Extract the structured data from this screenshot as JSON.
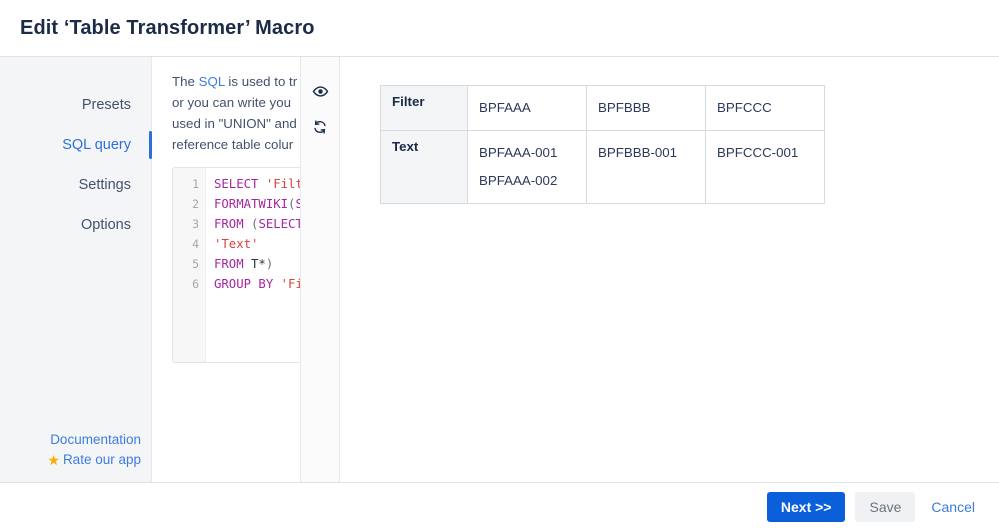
{
  "header": {
    "title": "Edit ‘Table Transformer’ Macro"
  },
  "sidebar": {
    "items": [
      {
        "label": "Presets",
        "active": false
      },
      {
        "label": "SQL query",
        "active": true
      },
      {
        "label": "Settings",
        "active": false
      },
      {
        "label": "Options",
        "active": false
      }
    ],
    "footer_links": [
      {
        "label": "Documentation",
        "icon": ""
      },
      {
        "label": "Rate our app",
        "icon": "star-icon"
      }
    ]
  },
  "config": {
    "help_lines": [
      {
        "pre": "The ",
        "link": "SQL",
        "post": " is used to tr"
      },
      {
        "pre": "or you can write you",
        "link": "",
        "post": ""
      },
      {
        "pre": "used in \"UNION\" and",
        "link": "",
        "post": ""
      },
      {
        "pre": "reference table colur",
        "link": "",
        "post": ""
      }
    ],
    "editor": {
      "line_numbers": [
        "1",
        "2",
        "3",
        "4",
        "5",
        "6"
      ],
      "lines": [
        "SELECT 'Filt",
        "FORMATWIKI(S",
        "FROM (SELECT",
        "'Text'",
        "FROM T*)",
        "GROUP BY 'Fi"
      ]
    },
    "rail": [
      {
        "name": "eye-icon",
        "title": "Preview"
      },
      {
        "name": "refresh-icon",
        "title": "Refresh"
      }
    ]
  },
  "preview": {
    "table": {
      "rows": [
        {
          "head": "Filter",
          "cells": [
            [
              "BPFAAA"
            ],
            [
              "BPFBBB"
            ],
            [
              "BPFCCC"
            ]
          ]
        },
        {
          "head": "Text",
          "cells": [
            [
              "BPFAAA-001",
              "BPFAAA-002"
            ],
            [
              "BPFBBB-001"
            ],
            [
              "BPFCCC-001"
            ]
          ]
        }
      ]
    }
  },
  "footer": {
    "next_label": "Next >>",
    "save_label": "Save",
    "cancel_label": "Cancel"
  },
  "colors": {
    "accent": "#0b5fdb",
    "link": "#3d7ce0",
    "star": "#ffab00",
    "header_text": "#1c2b48",
    "sidebar_bg": "#f4f5f7",
    "border": "#dfe1e6"
  }
}
